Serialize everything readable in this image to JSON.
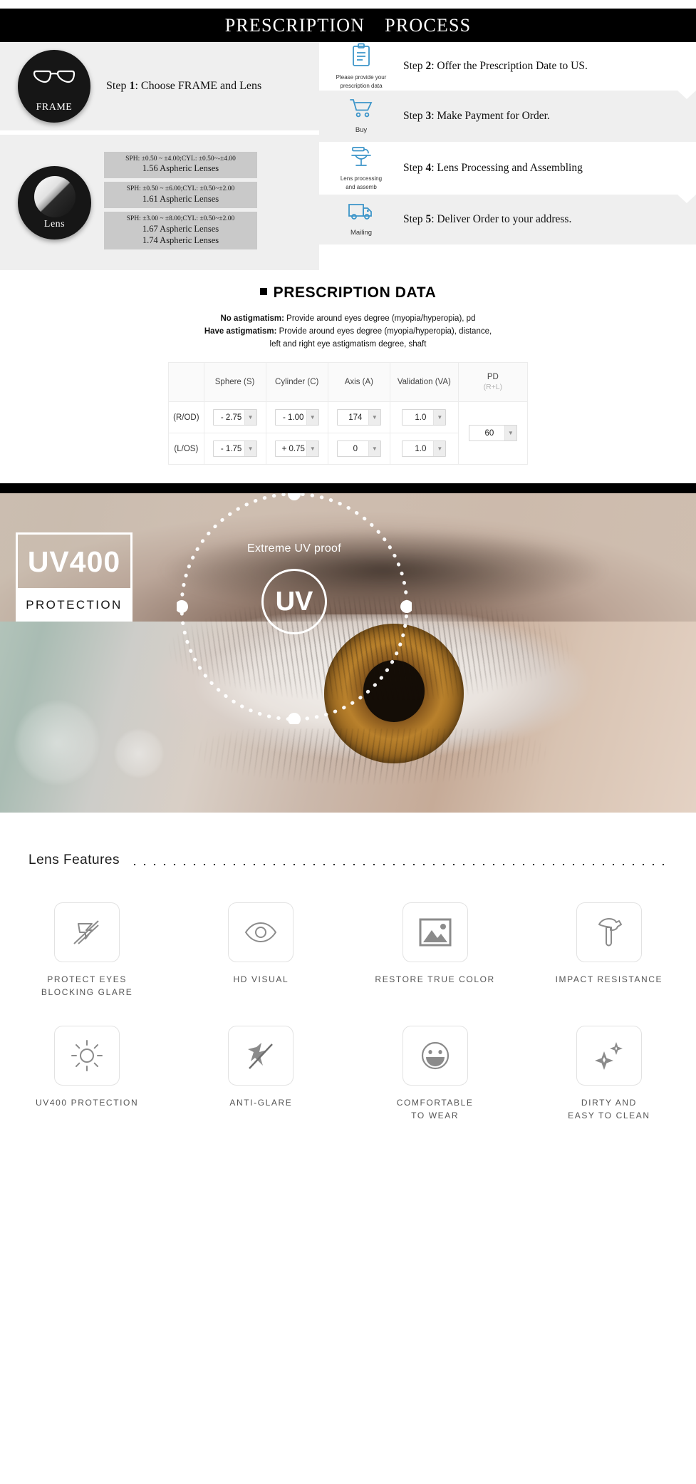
{
  "banner": {
    "word1": "PRESCRIPTION",
    "word2": "PROCESS"
  },
  "process": {
    "frame": {
      "circle_caption": "FRAME",
      "icon": "glasses-icon",
      "step_prefix": "Step ",
      "step_number": "1",
      "step_text": ": Choose FRAME and Lens"
    },
    "lens": {
      "circle_caption": "Lens",
      "icon": "lens-disc-icon",
      "specs": [
        {
          "range": "SPH: ±0.50 ~ ±4.00;CYL: ±0.50~-±4.00",
          "names": [
            "1.56 Aspheric Lenses"
          ]
        },
        {
          "range": "SPH: ±0.50 ~ ±6.00;CYL: ±0.50~±2.00",
          "names": [
            "1.61 Aspheric Lenses"
          ]
        },
        {
          "range": "SPH: ±3.00 ~ ±8.00;CYL: ±0.50~±2.00",
          "names": [
            "1.67 Aspheric Lenses",
            "1.74 Aspheric Lenses"
          ]
        }
      ]
    },
    "steps": [
      {
        "icon": "clipboard-icon",
        "icon_label": "Please provide your\nprescription data",
        "prefix": "Step ",
        "number": "2",
        "text": ": Offer the Prescription Date to US."
      },
      {
        "icon": "shopping-cart-icon",
        "icon_label": "Buy",
        "prefix": "Step ",
        "number": "3",
        "text": ": Make Payment for Order."
      },
      {
        "icon": "lens-machine-icon",
        "icon_label": "Lens processing\nand assemb",
        "prefix": "Step ",
        "number": "4",
        "text": ": Lens Processing and Assembling"
      },
      {
        "icon": "delivery-truck-icon",
        "icon_label": "Mailing",
        "prefix": "Step ",
        "number": "5",
        "text": ": Deliver Order to your address."
      }
    ]
  },
  "prescription": {
    "title": "PRESCRIPTION DATA",
    "notes": [
      {
        "label": "No astigmatism:",
        "text": "Provide around eyes degree (myopia/hyperopia), pd"
      },
      {
        "label": "Have astigmatism:",
        "text": "Provide around eyes degree (myopia/hyperopia), distance,"
      },
      {
        "label": "",
        "text": "left and right eye astigmatism degree, shaft"
      }
    ],
    "table": {
      "headers": [
        "Sphere (S)",
        "Cylinder (C)",
        "Axis (A)",
        "Validation (VA)"
      ],
      "pd_header": "PD",
      "pd_subheader": "(R+L)",
      "rows": [
        {
          "eye": "(R/OD)",
          "sphere": "- 2.75",
          "cylinder": "- 1.00",
          "axis": "174",
          "validation": "1.0"
        },
        {
          "eye": "(L/OS)",
          "sphere": "- 1.75",
          "cylinder": "+ 0.75",
          "axis": "0",
          "validation": "1.0"
        }
      ],
      "pd_value": "60"
    }
  },
  "uv": {
    "badge_top": "UV400",
    "badge_bottom": "PROTECTION",
    "ring_label": "Extreme UV proof",
    "ring_center": "UV"
  },
  "features": {
    "heading": "Lens Features",
    "items": [
      {
        "icon": "glare-block-icon",
        "caption": "PROTECT EYES\nBLOCKING GLARE"
      },
      {
        "icon": "eye-icon",
        "caption": "HD VISUAL"
      },
      {
        "icon": "photo-icon",
        "caption": "RESTORE TRUE COLOR"
      },
      {
        "icon": "hammer-icon",
        "caption": "IMPACT RESISTANCE"
      },
      {
        "icon": "sun-icon",
        "caption": "UV400 PROTECTION"
      },
      {
        "icon": "no-flash-icon",
        "caption": "ANTI-GLARE"
      },
      {
        "icon": "smiley-icon",
        "caption": "COMFORTABLE\nTO WEAR"
      },
      {
        "icon": "sparkle-icon",
        "caption": "DIRTY AND\nEASY TO CLEAN"
      }
    ]
  },
  "colors": {
    "banner_bg": "#000000",
    "panel_bg": "#efefef",
    "spec_bg": "#c9c9c9",
    "icon_blue": "#3d95c9"
  }
}
